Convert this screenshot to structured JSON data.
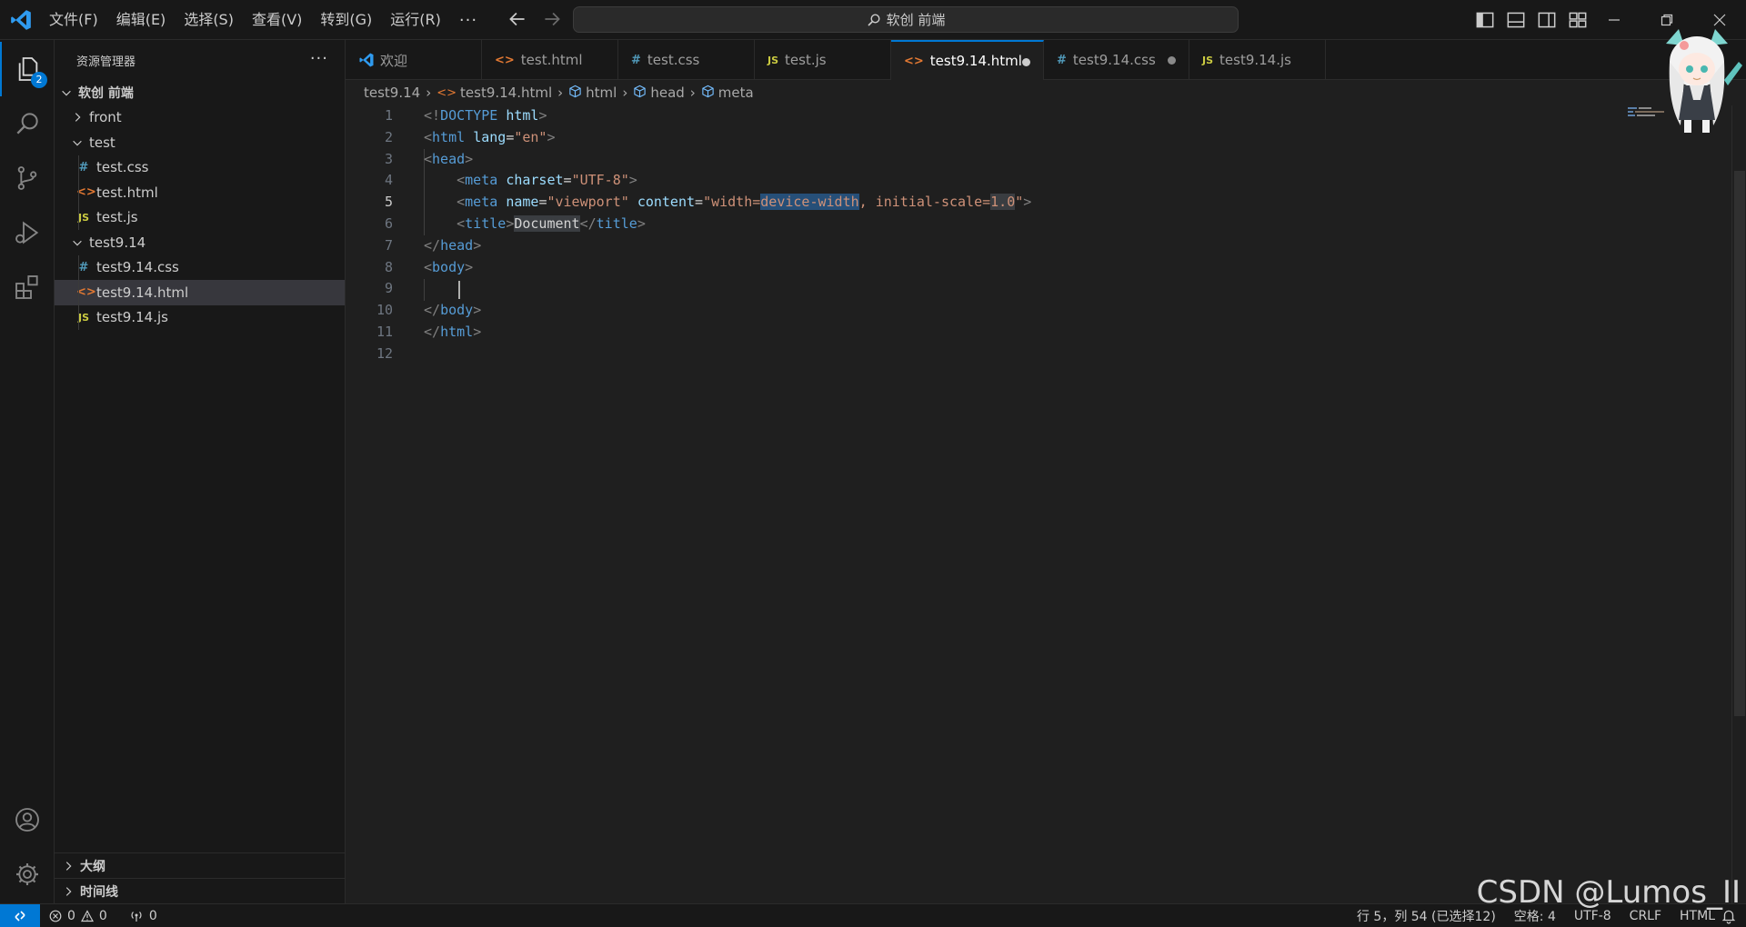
{
  "titlebar": {
    "menu": [
      "文件(F)",
      "编辑(E)",
      "选择(S)",
      "查看(V)",
      "转到(G)",
      "运行(R)"
    ],
    "more": "···",
    "command_center": "软创 前端"
  },
  "activitybar": {
    "explorer_badge": "2",
    "items": [
      "files-icon",
      "search-icon",
      "source-control-icon",
      "run-debug-icon",
      "extensions-icon",
      "account-icon",
      "gear-icon"
    ]
  },
  "sidebar": {
    "title": "资源管理器",
    "more": "···",
    "root": "软创 前端",
    "tree": [
      {
        "label": "front",
        "type": "folder",
        "expanded": false,
        "depth": 1
      },
      {
        "label": "test",
        "type": "folder",
        "expanded": true,
        "depth": 1
      },
      {
        "label": "test.css",
        "type": "css",
        "depth": 2
      },
      {
        "label": "test.html",
        "type": "html",
        "depth": 2
      },
      {
        "label": "test.js",
        "type": "js",
        "depth": 2
      },
      {
        "label": "test9.14",
        "type": "folder",
        "expanded": true,
        "depth": 1
      },
      {
        "label": "test9.14.css",
        "type": "css",
        "depth": 2
      },
      {
        "label": "test9.14.html",
        "type": "html",
        "depth": 2,
        "selected": true
      },
      {
        "label": "test9.14.js",
        "type": "js",
        "depth": 2
      }
    ],
    "outline": "大纲",
    "timeline": "时间线"
  },
  "tabs": [
    {
      "label": "欢迎",
      "icon": "vscode",
      "width": 150
    },
    {
      "label": "test.html",
      "icon": "html",
      "width": 150
    },
    {
      "label": "test.css",
      "icon": "css",
      "width": 150
    },
    {
      "label": "test.js",
      "icon": "js",
      "width": 150
    },
    {
      "label": "test9.14.html",
      "icon": "html",
      "active": true,
      "dirty": true,
      "width": 168
    },
    {
      "label": "test9.14.css",
      "icon": "css",
      "dirty": true,
      "width": 160
    },
    {
      "label": "test9.14.js",
      "icon": "js",
      "width": 150
    }
  ],
  "breadcrumb": {
    "folder": "test9.14",
    "file": "test9.14.html",
    "symbols": [
      "html",
      "head",
      "meta"
    ]
  },
  "editor": {
    "current_line": 5,
    "lines": [
      [
        [
          "p",
          "<!"
        ],
        [
          "t",
          "DOCTYPE"
        ],
        [
          "x",
          " "
        ],
        [
          "a",
          "html"
        ],
        [
          "p",
          ">"
        ]
      ],
      [
        [
          "p",
          "<"
        ],
        [
          "t",
          "html"
        ],
        [
          "x",
          " "
        ],
        [
          "a",
          "lang"
        ],
        [
          "x",
          "="
        ],
        [
          "s",
          "\"en\""
        ],
        [
          "p",
          ">"
        ]
      ],
      [
        [
          "p",
          "<"
        ],
        [
          "t",
          "head"
        ],
        [
          "p",
          ">"
        ]
      ],
      [
        [
          "x",
          "    "
        ],
        [
          "p",
          "<"
        ],
        [
          "t",
          "meta"
        ],
        [
          "x",
          " "
        ],
        [
          "a",
          "charset"
        ],
        [
          "x",
          "="
        ],
        [
          "s",
          "\"UTF-8\""
        ],
        [
          "p",
          ">"
        ]
      ],
      [
        [
          "x",
          "    "
        ],
        [
          "p",
          "<"
        ],
        [
          "t",
          "meta"
        ],
        [
          "x",
          " "
        ],
        [
          "a",
          "name"
        ],
        [
          "x",
          "="
        ],
        [
          "s",
          "\"viewport\""
        ],
        [
          "x",
          " "
        ],
        [
          "a",
          "content"
        ],
        [
          "x",
          "="
        ],
        [
          "s",
          "\"width="
        ],
        [
          "S",
          "device-width"
        ],
        [
          "s",
          ", initial-scale="
        ],
        [
          "H",
          "1.0"
        ],
        [
          "s",
          "\""
        ],
        [
          "p",
          ">"
        ]
      ],
      [
        [
          "x",
          "    "
        ],
        [
          "p",
          "<"
        ],
        [
          "t",
          "title"
        ],
        [
          "p",
          ">"
        ],
        [
          "h",
          "Document"
        ],
        [
          "p",
          "</"
        ],
        [
          "t",
          "title"
        ],
        [
          "p",
          ">"
        ]
      ],
      [
        [
          "p",
          "</"
        ],
        [
          "t",
          "head"
        ],
        [
          "p",
          ">"
        ]
      ],
      [
        [
          "p",
          "<"
        ],
        [
          "t",
          "body"
        ],
        [
          "p",
          ">"
        ]
      ],
      [
        [
          "x",
          ""
        ]
      ],
      [
        [
          "p",
          "</"
        ],
        [
          "t",
          "body"
        ],
        [
          "p",
          ">"
        ]
      ],
      [
        [
          "p",
          "</"
        ],
        [
          "t",
          "html"
        ],
        [
          "p",
          ">"
        ]
      ],
      [
        [
          "x",
          ""
        ]
      ]
    ]
  },
  "statusbar": {
    "errors": "0",
    "warnings": "0",
    "ports": "0",
    "position": "行 5，列 54 (已选择12)",
    "spaces": "空格: 4",
    "encoding": "UTF-8",
    "eol": "CRLF",
    "language": "HTML"
  },
  "watermark": "CSDN @Lumos_II",
  "colors": {
    "accent": "#0078d4",
    "background": "#1f1f1f",
    "sidebar": "#181818"
  }
}
